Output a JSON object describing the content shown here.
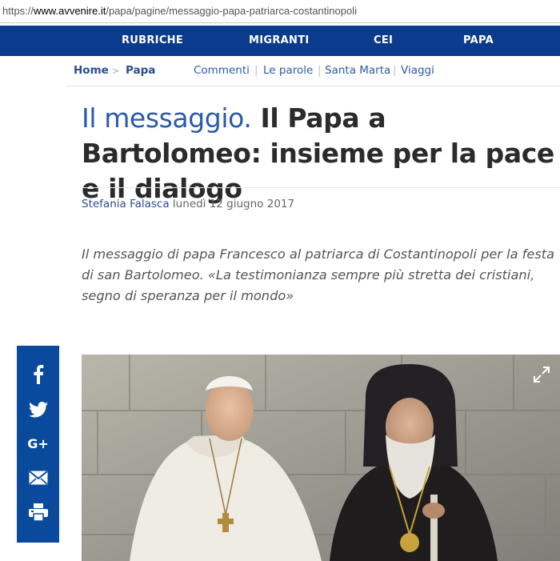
{
  "browser": {
    "url_protocol": "https://",
    "url_domain": "www.avvenire.it",
    "url_path": "/papa/pagine/messaggio-papa-patriarca-costantinopoli"
  },
  "topnav": {
    "items": [
      "RUBRICHE",
      "MIGRANTI",
      "CEI",
      "PAPA"
    ]
  },
  "breadcrumb": {
    "home": "Home",
    "separator": ">",
    "current": "Papa"
  },
  "subnav": {
    "links": [
      "Commenti",
      "Le parole",
      "Santa Marta",
      "Viaggi"
    ],
    "separator": "|"
  },
  "article": {
    "kicker": "Il messaggio.",
    "title": "Il Papa a Bartolomeo: insieme per la pace e il dialogo",
    "author": "Stefania Falasca",
    "date": "lunedì 12 giugno 2017",
    "summary": "Il messaggio di papa Francesco al patriarca di Costantinopoli per la festa di san Bartolomeo. «La testimonianza sempre più stretta dei cristiani, segno di speranza per il mondo»"
  },
  "share": {
    "icons": [
      "facebook-icon",
      "twitter-icon",
      "google-plus-icon",
      "email-icon",
      "print-icon"
    ],
    "gplus_label": "G+"
  },
  "photo": {
    "expand_icon": "expand-icon"
  },
  "colors": {
    "nav_bg": "#0a3b8c",
    "share_bg": "#0a4a9c",
    "accent": "#2a5aa8"
  }
}
